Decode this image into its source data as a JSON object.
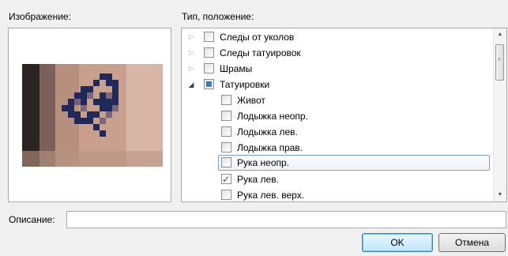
{
  "image_panel": {
    "label": "Изображение:"
  },
  "tree_panel": {
    "label": "Тип, положение:",
    "items": [
      {
        "label": "Следы от уколов",
        "level": 0,
        "expander": "collapsed",
        "state": "unchecked"
      },
      {
        "label": "Следы татуировок",
        "level": 0,
        "expander": "collapsed",
        "state": "unchecked"
      },
      {
        "label": "Шрамы",
        "level": 0,
        "expander": "collapsed",
        "state": "unchecked"
      },
      {
        "label": "Татуировки",
        "level": 0,
        "expander": "expanded",
        "state": "indeterminate"
      },
      {
        "label": "Живот",
        "level": 1,
        "state": "unchecked"
      },
      {
        "label": "Лодыжка неопр.",
        "level": 1,
        "state": "unchecked"
      },
      {
        "label": "Лодыжка лев.",
        "level": 1,
        "state": "unchecked"
      },
      {
        "label": "Лодыжка прав.",
        "level": 1,
        "state": "unchecked"
      },
      {
        "label": "Рука неопр.",
        "level": 1,
        "state": "unchecked",
        "focused": true
      },
      {
        "label": "Рука лев.",
        "level": 1,
        "state": "checked"
      },
      {
        "label": "Рука лев. верх.",
        "level": 1,
        "state": "unchecked"
      }
    ]
  },
  "description": {
    "label": "Описание:",
    "value": ""
  },
  "buttons": {
    "ok": "OK",
    "cancel": "Отмена"
  },
  "icons": {
    "expander_collapsed": "triangle-right-icon",
    "expander_expanded": "triangle-down-icon"
  }
}
